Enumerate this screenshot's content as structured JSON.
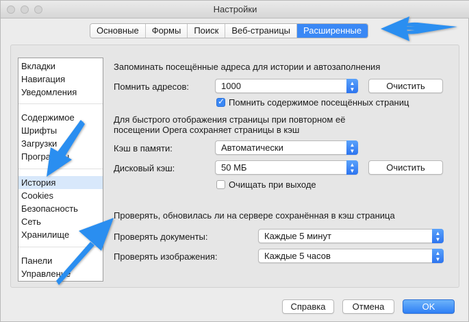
{
  "window": {
    "title": "Настройки"
  },
  "tabs": [
    {
      "label": "Основные",
      "active": false
    },
    {
      "label": "Формы",
      "active": false
    },
    {
      "label": "Поиск",
      "active": false
    },
    {
      "label": "Веб-страницы",
      "active": false
    },
    {
      "label": "Расширенные",
      "active": true
    }
  ],
  "sidebar": {
    "items": [
      {
        "label": "Вкладки"
      },
      {
        "label": "Навигация"
      },
      {
        "label": "Уведомления"
      },
      {
        "label": "Содержимое"
      },
      {
        "label": "Шрифты"
      },
      {
        "label": "Загрузки"
      },
      {
        "label": "Программы"
      },
      {
        "label": "История",
        "selected": true
      },
      {
        "label": "Cookies"
      },
      {
        "label": "Безопасность"
      },
      {
        "label": "Сеть"
      },
      {
        "label": "Хранилище"
      },
      {
        "label": "Панели"
      },
      {
        "label": "Управление"
      }
    ]
  },
  "history": {
    "remember_heading": "Запоминать посещённые адреса для истории и автозаполнения",
    "remember_label": "Помнить адресов:",
    "remember_value": "1000",
    "clear_label": "Очистить",
    "remember_content_label": "Помнить содержимое посещённых страниц",
    "remember_content_checked": true,
    "cache_heading_1": "Для быстрого отображения страницы при повторном её",
    "cache_heading_2": "посещении Opera сохраняет страницы в кэш",
    "memory_cache_label": "Кэш в памяти:",
    "memory_cache_value": "Автоматически",
    "disk_cache_label": "Дисковый кэш:",
    "disk_cache_value": "50 МБ",
    "disk_clear_label": "Очистить",
    "clear_on_exit_label": "Очищать при выходе",
    "clear_on_exit_checked": false,
    "check_heading": "Проверять, обновилась ли на сервере сохранённая в кэш страница",
    "check_documents_label": "Проверять документы:",
    "check_documents_value": "Каждые 5 минут",
    "check_images_label": "Проверять изображения:",
    "check_images_value": "Каждые 5 часов"
  },
  "footer": {
    "help_label": "Справка",
    "cancel_label": "Отмена",
    "ok_label": "OK"
  },
  "colors": {
    "accent": "#3a88f5",
    "annotation_arrow": "#2b8ef0"
  },
  "icons": [
    "close-icon",
    "minimize-icon",
    "zoom-icon",
    "chevron-updown-icon",
    "checkmark-icon",
    "annotation-arrow-icon"
  ]
}
